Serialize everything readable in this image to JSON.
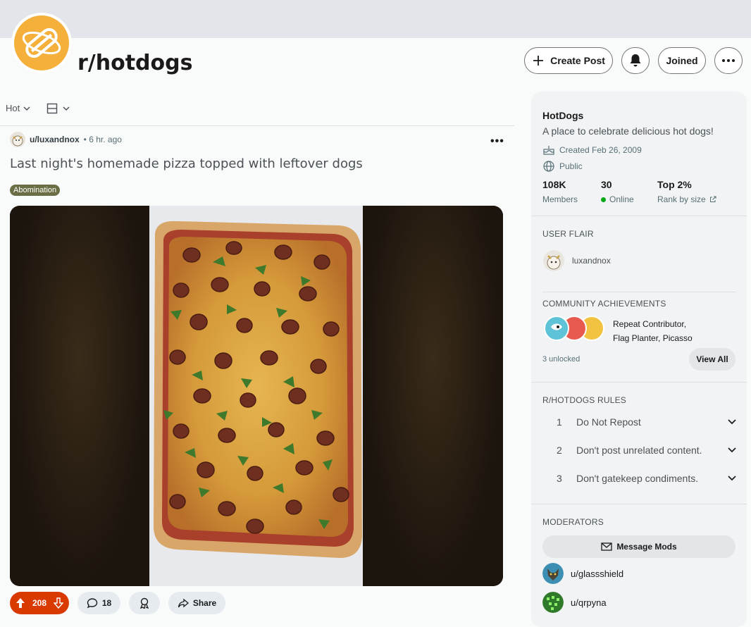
{
  "subreddit": {
    "name": "r/hotdogs"
  },
  "header": {
    "create_post_label": "Create Post",
    "joined_label": "Joined"
  },
  "sort": {
    "label": "Hot"
  },
  "post": {
    "author": "u/luxandnox",
    "time": "• 6 hr. ago",
    "title": "Last night's homemade pizza topped with leftover dogs",
    "flair": "Abomination",
    "score": "208",
    "comments": "18",
    "share_label": "Share"
  },
  "sidebar": {
    "name": "HotDogs",
    "description": "A place to celebrate delicious hot dogs!",
    "created": "Created Feb 26, 2009",
    "visibility": "Public",
    "stats": [
      {
        "value": "108K",
        "label": "Members"
      },
      {
        "value": "30",
        "label": "Online"
      },
      {
        "value": "Top 2%",
        "label": "Rank by size"
      }
    ],
    "user_flair_heading": "USER FLAIR",
    "user_flair_name": "luxandnox",
    "achievements_heading": "COMMUNITY ACHIEVEMENTS",
    "achievements_line1": "Repeat Contributor,",
    "achievements_line2": "Flag Planter, Picasso",
    "unlocked": "3 unlocked",
    "view_all": "View All",
    "rules_heading": "R/HOTDOGS RULES",
    "rules": [
      {
        "num": "1",
        "text": "Do Not Repost"
      },
      {
        "num": "2",
        "text": "Don't post unrelated content."
      },
      {
        "num": "3",
        "text": "Don't gatekeep condiments."
      }
    ],
    "moderators_heading": "MODERATORS",
    "message_mods": "Message Mods",
    "moderators": [
      "u/glassshield",
      "u/qrpyna"
    ]
  },
  "colors": {
    "upvote_bg": "#d93a00",
    "icon_orange": "#f4b03a",
    "flair_bg": "#6b6e45",
    "online": "#01a816"
  }
}
